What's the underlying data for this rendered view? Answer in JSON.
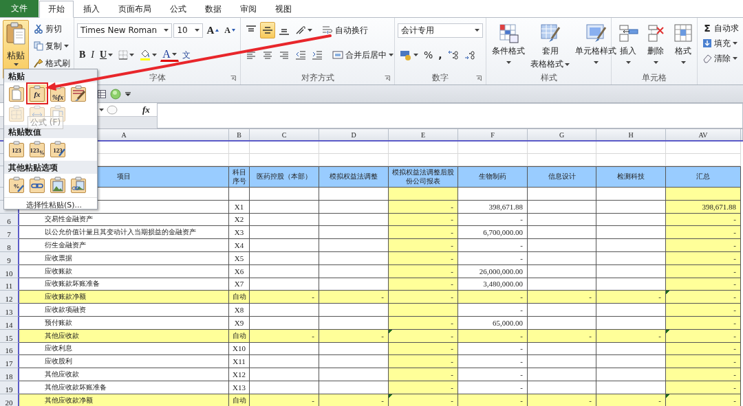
{
  "tabs": [
    {
      "label": "文件",
      "kind": "file",
      "selected": false
    },
    {
      "label": "开始",
      "kind": "tab",
      "selected": true
    },
    {
      "label": "插入",
      "kind": "tab",
      "selected": false
    },
    {
      "label": "页面布局",
      "kind": "tab",
      "selected": false
    },
    {
      "label": "公式",
      "kind": "tab",
      "selected": false
    },
    {
      "label": "数据",
      "kind": "tab",
      "selected": false
    },
    {
      "label": "审阅",
      "kind": "tab",
      "selected": false
    },
    {
      "label": "视图",
      "kind": "tab",
      "selected": false
    }
  ],
  "ribbon": {
    "clipboard": {
      "paste": "粘贴",
      "paste_open": true,
      "cut": "剪切",
      "copy": "复制",
      "format_painter": "格式刷"
    },
    "font": {
      "name": "Times New Roman",
      "size": "10",
      "grow": "A",
      "shrink": "A",
      "bold": "B",
      "italic": "I",
      "underline": "U",
      "color_letter": "A",
      "phonetic": "文",
      "label": "字体"
    },
    "alignment": {
      "vertical": [
        {
          "kind": "top",
          "selected": false
        },
        {
          "kind": "middle",
          "selected": true
        },
        {
          "kind": "bottom",
          "selected": false
        }
      ],
      "horizontal": [
        {
          "kind": "left",
          "selected": false
        },
        {
          "kind": "center",
          "selected": false
        },
        {
          "kind": "right",
          "selected": false
        }
      ],
      "wrap": "自动换行",
      "merge": "合并后居中",
      "label": "对齐方式"
    },
    "number": {
      "format": "会计专用",
      "percent": "%",
      "comma": ",",
      "label": "数字"
    },
    "styles": {
      "buttons": [
        {
          "kind": "conditional",
          "lines": [
            "条件格式"
          ]
        },
        {
          "kind": "table",
          "lines": [
            "套用",
            "表格格式"
          ]
        },
        {
          "kind": "cell-style",
          "lines": [
            "单元格样式"
          ]
        }
      ],
      "label": "样式"
    },
    "cells": {
      "buttons": [
        {
          "kind": "insert",
          "lines": [
            "插入"
          ]
        },
        {
          "kind": "delete",
          "lines": [
            "删除"
          ]
        },
        {
          "kind": "format",
          "lines": [
            "格式"
          ]
        }
      ],
      "label": "单元格"
    },
    "editing": {
      "sum": "Σ",
      "autosum": "自动求",
      "fill": "填充",
      "clear": "清除"
    }
  },
  "formula_bar": {
    "fx": "fx"
  },
  "paste_menu": {
    "sections": [
      {
        "heading": "粘贴",
        "options": [
          {
            "kind": "paste",
            "selected": false,
            "disabled": false
          },
          {
            "kind": "formula",
            "label": "fx",
            "selected": true,
            "disabled": false
          },
          {
            "kind": "formula-number",
            "label": "%fx",
            "selected": false,
            "disabled": false
          },
          {
            "kind": "source-format",
            "selected": false,
            "disabled": false
          },
          {
            "kind": "no-borders",
            "selected": false,
            "disabled": true
          },
          {
            "kind": "column-width",
            "selected": false,
            "disabled": true
          },
          {
            "kind": "transpose",
            "selected": false,
            "disabled": true
          }
        ]
      },
      {
        "heading": "粘贴数值",
        "options": [
          {
            "kind": "values",
            "label": "123",
            "selected": false,
            "disabled": false
          },
          {
            "kind": "values-number",
            "label": "123$_{%}$",
            "selected": false,
            "disabled": false
          },
          {
            "kind": "values-format",
            "label": "123",
            "selected": false,
            "disabled": false
          }
        ]
      },
      {
        "heading": "其他粘贴选项",
        "options": [
          {
            "kind": "formatting",
            "label": "%",
            "selected": false,
            "disabled": false
          },
          {
            "kind": "link",
            "selected": false,
            "disabled": false
          },
          {
            "kind": "picture",
            "selected": false,
            "disabled": false
          },
          {
            "kind": "linked-picture",
            "selected": false,
            "disabled": false
          }
        ]
      }
    ],
    "tooltip": "公式 (F)",
    "special": "选择性粘贴(S)..."
  },
  "sheet": {
    "columns": [
      {
        "letter": "A",
        "title": "项目",
        "highlight": false
      },
      {
        "letter": "B",
        "title": "科目序号",
        "highlight": false
      },
      {
        "letter": "C",
        "title": "医药控股（本部）",
        "highlight": false
      },
      {
        "letter": "D",
        "title": "模拟权益法调整",
        "highlight": false
      },
      {
        "letter": "E",
        "title": "模拟权益法调整后股份公司报表",
        "highlight": true
      },
      {
        "letter": "F",
        "title": "生物制药",
        "highlight": false
      },
      {
        "letter": "G",
        "title": "信息设计",
        "highlight": false
      },
      {
        "letter": "H",
        "title": "检测科技",
        "highlight": false
      },
      {
        "letter": "AV",
        "title": "汇总",
        "highlight": true
      }
    ],
    "rows": [
      {
        "kind": "item",
        "code": "X1",
        "cells": {
          "E": "-",
          "F": "398,671.88",
          "AV": "398,671.88"
        }
      },
      {
        "number": "6",
        "kind": "item",
        "item": "交易性金融资产",
        "code": "X2",
        "cells": {
          "E": "-",
          "F": "-",
          "AV": "-"
        }
      },
      {
        "number": "7",
        "kind": "item",
        "item": "以公允价值计量且其变动计入当期损益的金融资产",
        "code": "X3",
        "cells": {
          "E": "-",
          "F": "6,700,000.00",
          "AV": "-"
        }
      },
      {
        "number": "8",
        "kind": "item",
        "item": "衍生金融资产",
        "code": "X4",
        "cells": {
          "E": "-",
          "F": "-",
          "AV": "-"
        }
      },
      {
        "number": "9",
        "kind": "item",
        "item": "应收票据",
        "code": "X5",
        "cells": {
          "E": "-",
          "F": "-",
          "AV": "-"
        }
      },
      {
        "number": "10",
        "kind": "item",
        "item": "应收账款",
        "code": "X6",
        "cells": {
          "E": "-",
          "F": "26,000,000.00",
          "AV": "-"
        }
      },
      {
        "number": "11",
        "kind": "item",
        "item": "应收账款坏账准备",
        "code": "X7",
        "cells": {
          "E": "-",
          "F": "3,480,000.00",
          "AV": "-"
        }
      },
      {
        "number": "12",
        "kind": "subtotal",
        "item": "应收账款净额",
        "code": "自动",
        "cells": {
          "C": "-",
          "D": "-",
          "E": "-",
          "F": "-",
          "G": "-",
          "H": "-",
          "AV": "-"
        },
        "flags": {
          "AV": true
        }
      },
      {
        "number": "13",
        "kind": "item",
        "item": "应收款项融资",
        "code": "X8",
        "cells": {
          "F": "-",
          "AV": "-"
        }
      },
      {
        "number": "14",
        "kind": "item",
        "item": "预付账款",
        "code": "X9",
        "cells": {
          "E": "-",
          "F": "65,000.00",
          "AV": "-"
        }
      },
      {
        "number": "15",
        "kind": "subtotal",
        "item": "其他应收款",
        "code": "自动",
        "cells": {
          "C": "-",
          "D": "-",
          "E": "-",
          "F": "-",
          "G": "-",
          "H": "-",
          "AV": "-"
        },
        "flags": {
          "E": true,
          "AV": true
        }
      },
      {
        "number": "16",
        "kind": "item",
        "item": "应收利息",
        "code": "X10",
        "cells": {
          "E": "-",
          "F": "-",
          "AV": "-"
        }
      },
      {
        "number": "17",
        "kind": "item",
        "item": "应收股利",
        "code": "X11",
        "cells": {
          "E": "-",
          "F": "-",
          "AV": "-"
        }
      },
      {
        "number": "18",
        "kind": "item",
        "item": "其他应收款",
        "code": "X12",
        "cells": {
          "E": "-",
          "F": "-",
          "AV": "-"
        }
      },
      {
        "number": "19",
        "kind": "item",
        "item": "其他应收款坏账准备",
        "code": "X13",
        "cells": {
          "E": "-",
          "F": "-",
          "AV": "-"
        }
      },
      {
        "number": "20",
        "kind": "subtotal",
        "item": "其他应收款净额",
        "code": "自动",
        "cells": {
          "C": "-",
          "D": "-",
          "E": "-",
          "F": "-",
          "G": "-",
          "H": "-",
          "AV": "-"
        },
        "flags": {
          "E": true,
          "AV": true
        }
      }
    ]
  }
}
